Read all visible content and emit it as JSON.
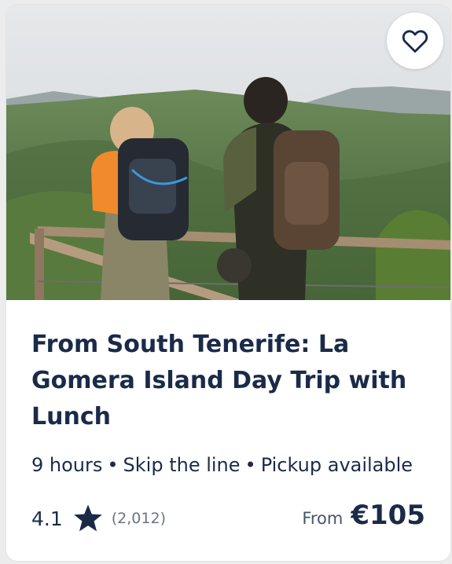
{
  "card": {
    "image_alt": "Two hikers with backpacks at a wooden railing overlooking green mountains",
    "wishlist_icon": "heart-outline-icon",
    "title": "From South Tenerife: La Gomera Island Day Trip with Lunch",
    "duration": "9 hours",
    "feature_1": "Skip the line",
    "feature_2": "Pickup available",
    "separator": "•",
    "rating": "4.1",
    "rating_icon": "star-icon",
    "review_count": "(2,012)",
    "price_prefix": "From",
    "price": "€105"
  },
  "colors": {
    "text": "#1a2b49",
    "muted": "#6b7385",
    "background": "#ffffff"
  }
}
